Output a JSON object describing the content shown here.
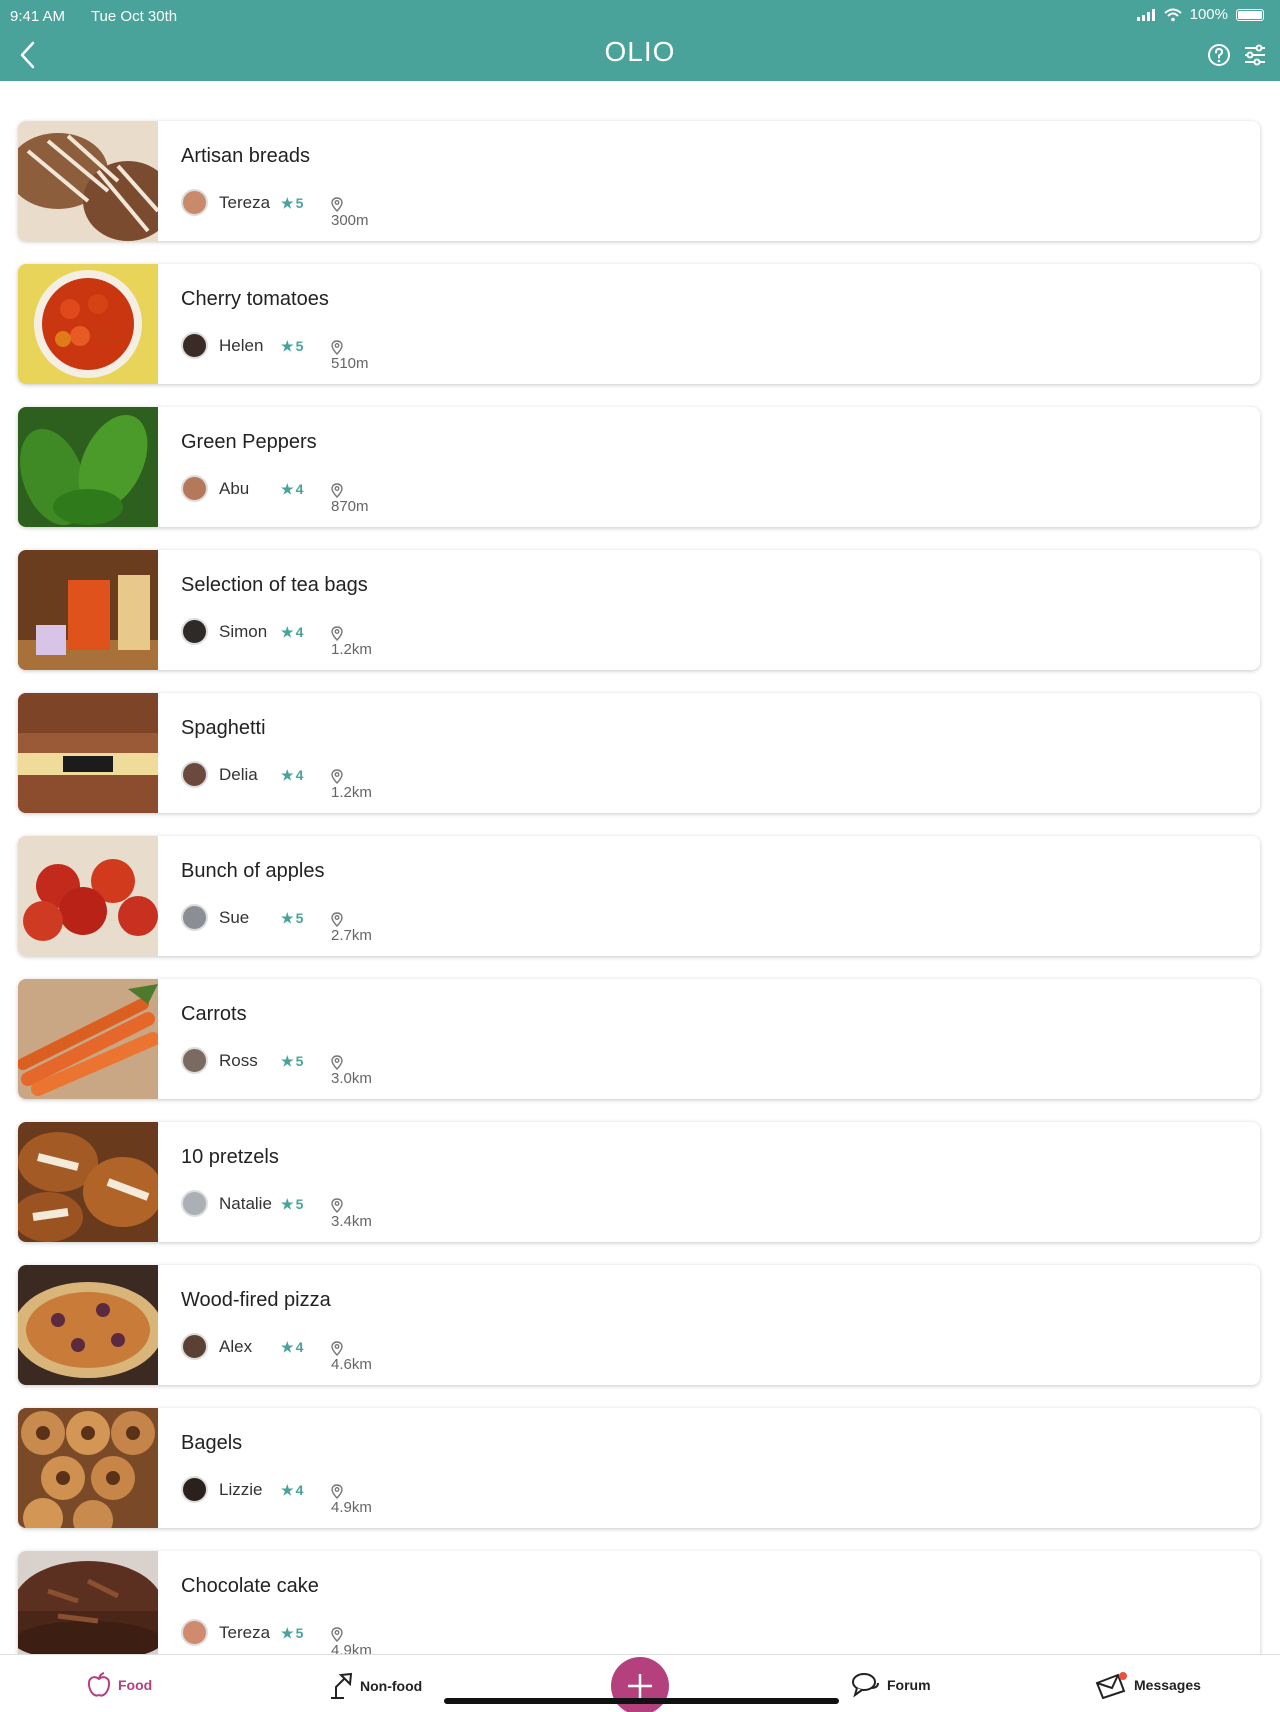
{
  "status_bar": {
    "time": "9:41 AM",
    "date": "Tue Oct 30th",
    "battery": "100%"
  },
  "header": {
    "title": "OLIO"
  },
  "colors": {
    "brand": "#4aa39a",
    "accent": "#b5407e"
  },
  "items": [
    {
      "title": "Artisan breads",
      "user": "Tereza",
      "rating": "5",
      "distance": "300m",
      "thumb": "bread"
    },
    {
      "title": "Cherry tomatoes",
      "user": "Helen",
      "rating": "5",
      "distance": "510m",
      "thumb": "tomatoes"
    },
    {
      "title": "Green Peppers",
      "user": "Abu",
      "rating": "4",
      "distance": "870m",
      "thumb": "peppers"
    },
    {
      "title": "Selection of tea bags",
      "user": "Simon",
      "rating": "4",
      "distance": "1.2km",
      "thumb": "tea"
    },
    {
      "title": "Spaghetti",
      "user": "Delia",
      "rating": "4",
      "distance": "1.2km",
      "thumb": "spaghetti"
    },
    {
      "title": "Bunch of apples",
      "user": "Sue",
      "rating": "5",
      "distance": "2.7km",
      "thumb": "apples"
    },
    {
      "title": "Carrots",
      "user": "Ross",
      "rating": "5",
      "distance": "3.0km",
      "thumb": "carrots"
    },
    {
      "title": "10 pretzels",
      "user": "Natalie",
      "rating": "5",
      "distance": "3.4km",
      "thumb": "pretzels"
    },
    {
      "title": "Wood-fired pizza",
      "user": "Alex",
      "rating": "4",
      "distance": "4.6km",
      "thumb": "pizza"
    },
    {
      "title": "Bagels",
      "user": "Lizzie",
      "rating": "4",
      "distance": "4.9km",
      "thumb": "bagels"
    },
    {
      "title": "Chocolate cake",
      "user": "Tereza",
      "rating": "5",
      "distance": "4.9km",
      "thumb": "cake"
    }
  ],
  "tabs": {
    "food": "Food",
    "nonfood": "Non-food",
    "forum": "Forum",
    "messages": "Messages"
  }
}
